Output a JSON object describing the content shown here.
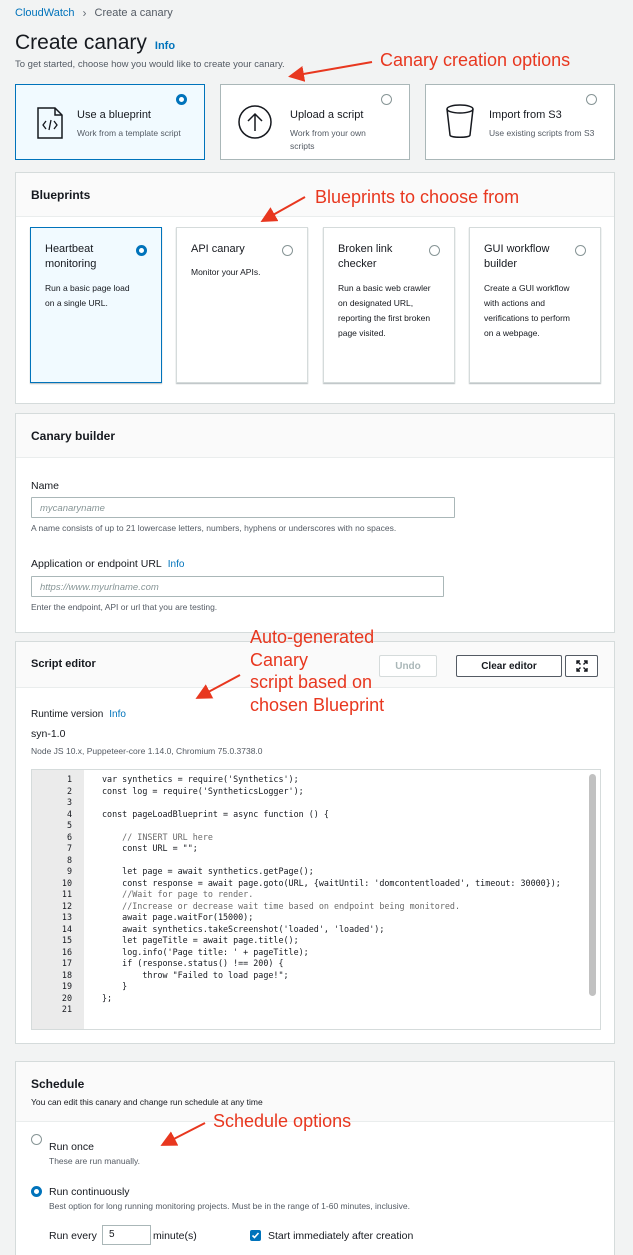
{
  "breadcrumb": {
    "root": "CloudWatch",
    "current": "Create a canary"
  },
  "page": {
    "title": "Create canary",
    "info": "Info",
    "subtitle": "To get started, choose how you would like to create your canary."
  },
  "creation_options": [
    {
      "title": "Use a blueprint",
      "desc": "Work from a template script",
      "icon": "code-file-icon",
      "selected": true
    },
    {
      "title": "Upload a script",
      "desc": "Work from your own scripts",
      "icon": "upload-icon",
      "selected": false
    },
    {
      "title": "Import from S3",
      "desc": "Use existing scripts from S3",
      "icon": "s3-bucket-icon",
      "selected": false
    }
  ],
  "blueprints": {
    "heading": "Blueprints",
    "items": [
      {
        "title": "Heartbeat monitoring",
        "desc": "Run a basic page load on a single URL.",
        "selected": true
      },
      {
        "title": "API canary",
        "desc": "Monitor your APIs.",
        "selected": false
      },
      {
        "title": "Broken link checker",
        "desc": "Run a basic web crawler on designated URL, reporting the first broken page visited.",
        "selected": false
      },
      {
        "title": "GUI workflow builder",
        "desc": "Create a GUI workflow with actions and verifications to perform on a webpage.",
        "selected": false
      }
    ]
  },
  "builder": {
    "heading": "Canary builder",
    "name_label": "Name",
    "name_placeholder": "mycanaryname",
    "name_hint": "A name consists of up to 21 lowercase letters, numbers, hyphens or underscores with no spaces.",
    "url_label": "Application or endpoint URL",
    "url_info": "Info",
    "url_placeholder": "https://www.myurlname.com",
    "url_hint": "Enter the endpoint, API or url that you are testing."
  },
  "script_editor": {
    "heading": "Script editor",
    "undo": "Undo",
    "clear": "Clear editor",
    "fullscreen_icon": "expand-icon",
    "runtime_label": "Runtime version",
    "runtime_info": "Info",
    "runtime_value": "syn-1.0",
    "runtime_desc": "Node JS 10.x, Puppeteer-core 1.14.0, Chromium 75.0.3738.0",
    "lines": [
      "var synthetics = require('Synthetics');",
      "const log = require('SyntheticsLogger');",
      "",
      "const pageLoadBlueprint = async function () {",
      "",
      "    // INSERT URL here",
      "    const URL = \"\";",
      "",
      "    let page = await synthetics.getPage();",
      "    const response = await page.goto(URL, {waitUntil: 'domcontentloaded', timeout: 30000});",
      "    //Wait for page to render.",
      "    //Increase or decrease wait time based on endpoint being monitored.",
      "    await page.waitFor(15000);",
      "    await synthetics.takeScreenshot('loaded', 'loaded');",
      "    let pageTitle = await page.title();",
      "    log.info('Page title: ' + pageTitle);",
      "    if (response.status() !== 200) {",
      "        throw \"Failed to load page!\";",
      "    }",
      "};",
      ""
    ]
  },
  "schedule": {
    "heading": "Schedule",
    "subtitle": "You can edit this canary and change run schedule at any time",
    "run_once": "Run once",
    "run_once_desc": "These are run manually.",
    "run_cont": "Run continuously",
    "run_cont_desc": "Best option for long running monitoring projects. Must be in the range of 1-60 minutes, inclusive.",
    "run_every_label": "Run every",
    "run_every_value": "5",
    "unit": "minute(s)",
    "start_immediately": "Start immediately after creation"
  },
  "annotations": {
    "creation": "Canary creation options",
    "blueprints": "Blueprints to choose from",
    "autogen_1": "Auto-generated",
    "autogen_2": "Canary",
    "autogen_3": "script based on",
    "autogen_4": "chosen Blueprint",
    "schedule": "Schedule options",
    "color": "#e8371f"
  },
  "colors": {
    "accent": "#0073bb",
    "text": "#16191f",
    "muted": "#545b64",
    "background": "#f2f3f3"
  }
}
